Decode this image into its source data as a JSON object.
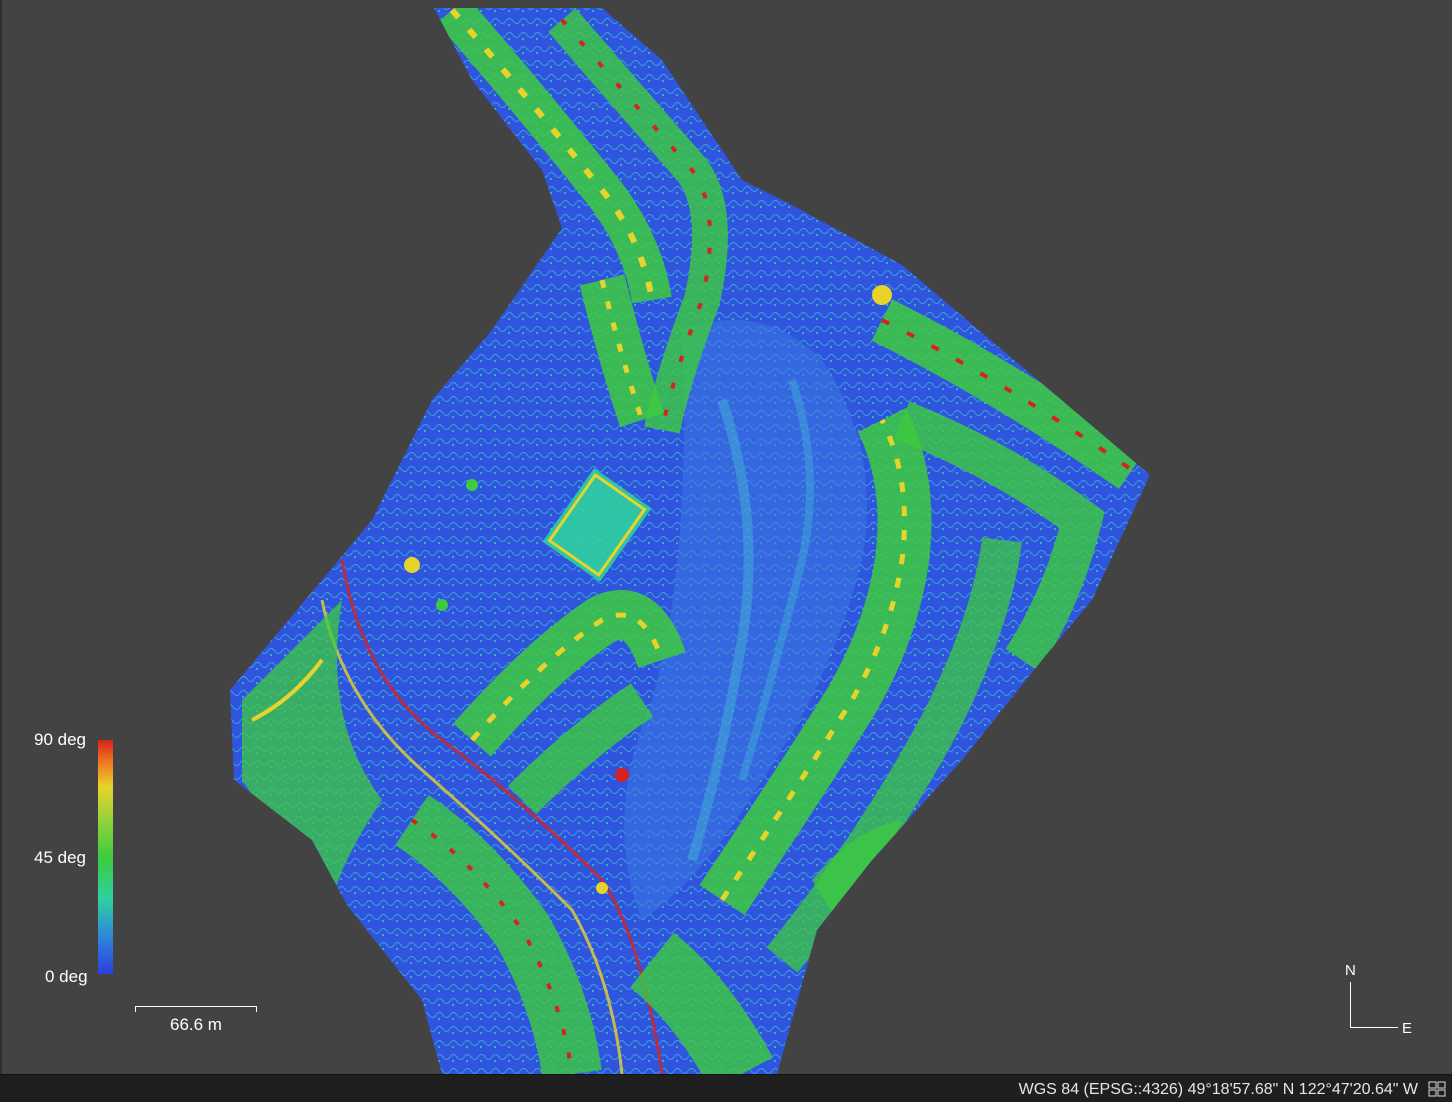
{
  "legend": {
    "title": "",
    "max_label": "90 deg",
    "mid_label": "45 deg",
    "min_label": "0 deg",
    "colors": [
      "#d7231b",
      "#e8d32a",
      "#3dcb3f",
      "#2fd0a0",
      "#2a3fe0"
    ]
  },
  "scalebar": {
    "label": "66.6 m"
  },
  "north_arrow": {
    "north": "N",
    "east": "E"
  },
  "statusbar": {
    "crs_and_coords": "WGS 84 (EPSG::4326)  49°18'57.68\" N  122°47'20.64\" W",
    "icon": "layout-grid-icon"
  },
  "viewport": {
    "background": "#434343",
    "raster_palette": [
      "#2a3fe0",
      "#3a78e0",
      "#2fd0a0",
      "#3dcb3f",
      "#e8d32a",
      "#d7231b"
    ]
  }
}
